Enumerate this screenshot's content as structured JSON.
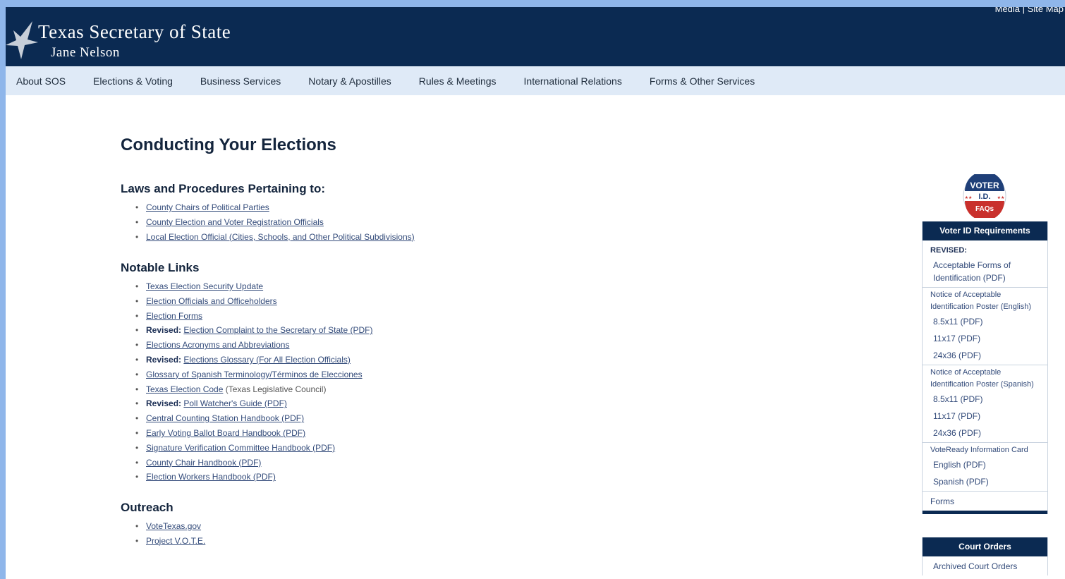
{
  "header": {
    "title": "Texas Secretary of State",
    "subtitle": "Jane Nelson",
    "util_media": "Media",
    "util_sep": "|",
    "util_sitemap": "Site Map"
  },
  "nav": {
    "items": [
      "About SOS",
      "Elections & Voting",
      "Business Services",
      "Notary & Apostilles",
      "Rules & Meetings",
      "International Relations",
      "Forms & Other Services"
    ]
  },
  "main": {
    "title": "Conducting Your Elections",
    "laws": {
      "heading": "Laws and Procedures Pertaining to:",
      "items": [
        "County Chairs of Political Parties",
        "County Election and Voter Registration Officials",
        "Local Election Official (Cities, Schools, and Other Political Subdivisions)"
      ]
    },
    "notable": {
      "heading": "Notable Links",
      "revised_label": "Revised:",
      "items": [
        {
          "link": "Texas Election Security Update"
        },
        {
          "link": "Election Officials and Officeholders"
        },
        {
          "link": "Election Forms"
        },
        {
          "prefix": "Revised:",
          "link": "Election Complaint to the Secretary of State (PDF)"
        },
        {
          "link": "Elections Acronyms and Abbreviations"
        },
        {
          "prefix": "Revised:",
          "link": "Elections Glossary (For All Election Officials)"
        },
        {
          "link": "Glossary of Spanish Terminology/Términos de Elecciones"
        },
        {
          "link": "Texas Election Code",
          "suffix": " (Texas Legislative Council)"
        },
        {
          "prefix": "Revised:",
          "link": "Poll Watcher's Guide (PDF)"
        },
        {
          "link": "Central Counting Station Handbook (PDF)"
        },
        {
          "link": "Early Voting Ballot Board Handbook (PDF)"
        },
        {
          "link": "Signature Verification Committee Handbook (PDF)"
        },
        {
          "link": "County Chair Handbook (PDF)"
        },
        {
          "link": "Election Workers Handbook (PDF)"
        }
      ]
    },
    "outreach": {
      "heading": "Outreach",
      "items": [
        "VoteTexas.gov",
        "Project V.O.T.E."
      ]
    }
  },
  "sidebar": {
    "badge": {
      "line1": "VOTER",
      "line2": "I.D.",
      "line3": "FAQs",
      "stars": "★★"
    },
    "voter_id": {
      "heading": "Voter ID Requirements",
      "revised_label": "REVISED:",
      "acceptable_forms": "Acceptable Forms of Identification (PDF)",
      "poster_english_label": "Notice of Acceptable Identification Poster (English)",
      "poster_english": [
        "8.5x11 (PDF)",
        "11x17 (PDF)",
        "24x36 (PDF)"
      ],
      "poster_spanish_label": "Notice of Acceptable Identification Poster (Spanish)",
      "poster_spanish": [
        "8.5x11 (PDF)",
        "11x17 (PDF)",
        "24x36 (PDF)"
      ],
      "voteready_label": "VoteReady Information Card",
      "voteready": [
        "English (PDF)",
        "Spanish (PDF)"
      ],
      "forms": "Forms"
    },
    "court_orders": {
      "heading": "Court Orders",
      "archived": "Archived Court Orders"
    }
  },
  "colors": {
    "header_bg": "#0b2a52",
    "nav_bg": "#dfeaf7",
    "link": "#334b7a",
    "page_bg": "#8fb6ea",
    "badge_red": "#c9302c",
    "badge_blue": "#1f3f78"
  },
  "icons": {
    "logo": "star-icon",
    "badge": "voter-id-badge-icon"
  }
}
